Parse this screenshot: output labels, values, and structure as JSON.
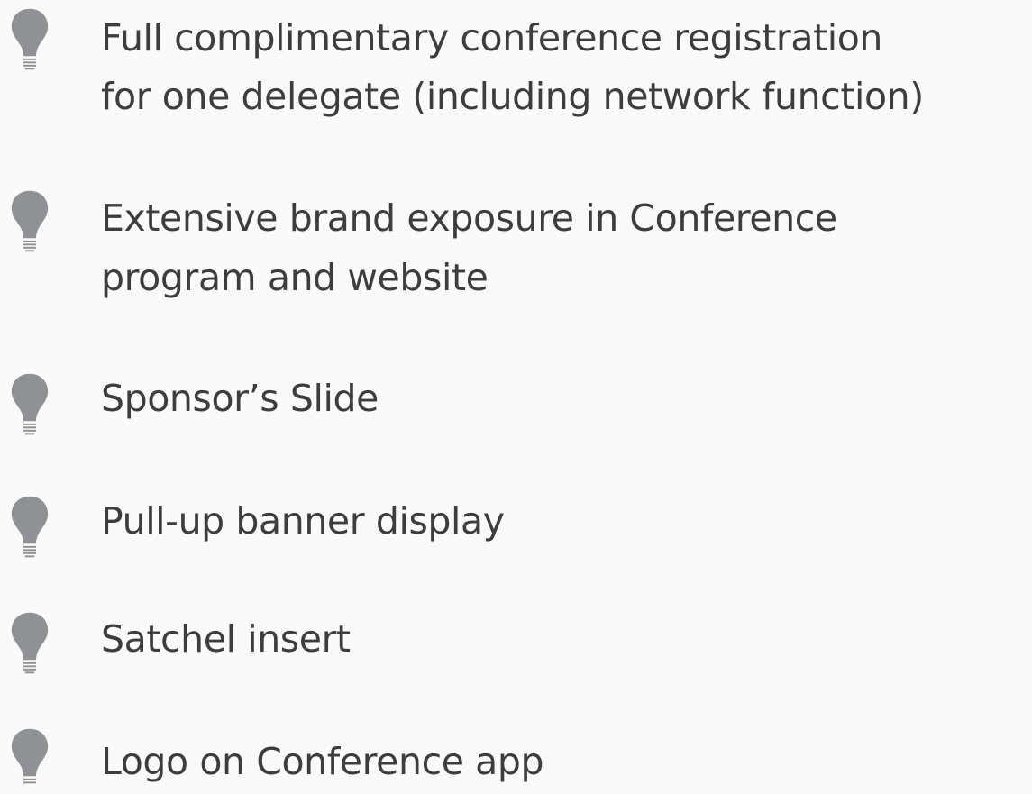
{
  "bullets": [
    {
      "lines": [
        "Full complimentary conference registration",
        "for one delegate (including network function)"
      ]
    },
    {
      "lines": [
        "Extensive brand exposure in Conference",
        "program and website"
      ]
    },
    {
      "lines": [
        "Sponsor’s Slide"
      ]
    },
    {
      "lines": [
        "Pull-up banner display"
      ]
    },
    {
      "lines": [
        "Satchel insert"
      ]
    },
    {
      "lines": [
        "Logo on Conference app"
      ]
    }
  ],
  "icon": "lightbulb-icon",
  "colors": {
    "text": "#3d3d3d",
    "icon": "#8e9196",
    "background": "#fafafa"
  }
}
